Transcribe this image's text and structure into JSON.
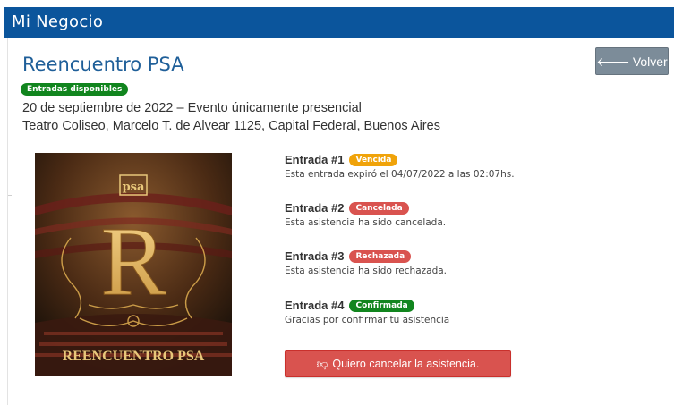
{
  "app": {
    "brand": "Mi Negocio"
  },
  "event": {
    "title": "Reencuentro PSA",
    "availability_badge": "Entradas disponibles",
    "date_line": "20 de septiembre de 2022 – Evento únicamente presencial",
    "venue_line": "Teatro Coliseo, Marcelo T. de Alvear 1125, Capital Federal, Buenos Aires"
  },
  "actions": {
    "back_label": "Volver",
    "back_icon": "arrow-left-icon",
    "cancel_label": "Quiero cancelar la asistencia.",
    "cancel_icon": "thumbs-down-icon"
  },
  "poster": {
    "logo_text": "psa",
    "letter": "R",
    "caption": "REENCUENTRO PSA"
  },
  "entries": [
    {
      "label": "Entrada #1",
      "status": "Vencida",
      "status_color": "#f0a30a",
      "description": "Esta entrada expiró el 04/07/2022 a las 02:07hs."
    },
    {
      "label": "Entrada #2",
      "status": "Cancelada",
      "status_color": "#d9534f",
      "description": "Esta asistencia ha sido cancelada."
    },
    {
      "label": "Entrada #3",
      "status": "Rechazada",
      "status_color": "#d9534f",
      "description": "Esta asistencia ha sido rechazada."
    },
    {
      "label": "Entrada #4",
      "status": "Confirmada",
      "status_color": "#11851e",
      "description": "Gracias por confirmar tu asistencia"
    }
  ],
  "colors": {
    "topbar": "#0b559c",
    "title": "#1f5f99",
    "success": "#11851e",
    "danger": "#d9534f",
    "warning": "#f0a30a",
    "back_button": "#7c8c99"
  }
}
